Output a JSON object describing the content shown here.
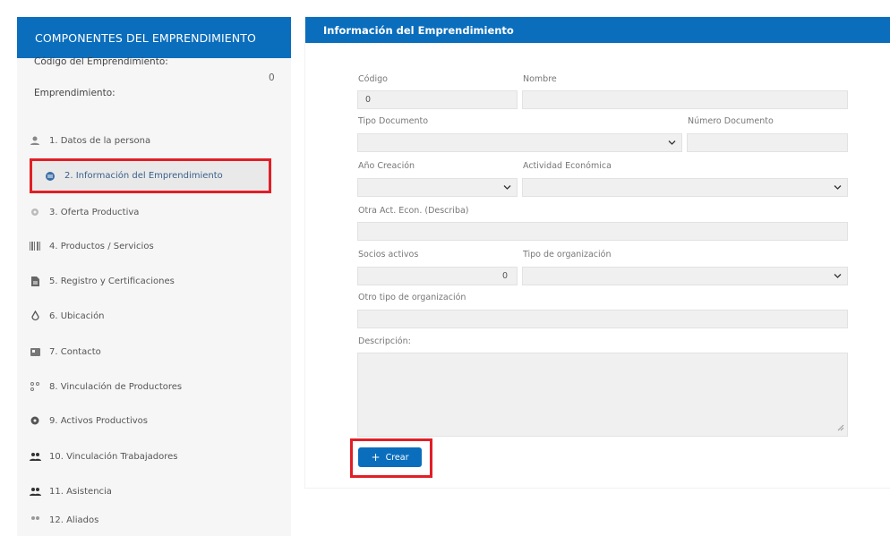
{
  "sidebar": {
    "header": "COMPONENTES DEL EMPRENDIMIENTO",
    "code_label": "Código del Emprendimiento:",
    "code_value": "0",
    "emp_label": "Emprendimiento:",
    "items": [
      {
        "label": "1. Datos de la persona",
        "icon": "person-icon"
      },
      {
        "label": "2. Información del Emprendimiento",
        "icon": "globe-icon"
      },
      {
        "label": "3. Oferta Productiva",
        "icon": "gear-icon"
      },
      {
        "label": "4. Productos / Servicios",
        "icon": "barcode-icon"
      },
      {
        "label": "5. Registro y Certificaciones",
        "icon": "document-icon"
      },
      {
        "label": "6. Ubicación",
        "icon": "map-pin-icon"
      },
      {
        "label": "7. Contacto",
        "icon": "contact-card-icon"
      },
      {
        "label": "8. Vinculación de Productores",
        "icon": "network-icon"
      },
      {
        "label": "9. Activos Productivos",
        "icon": "cog-icon"
      },
      {
        "label": "10. Vinculación Trabajadores",
        "icon": "users-icon"
      },
      {
        "label": "11. Asistencia",
        "icon": "users-icon"
      },
      {
        "label": "12. Aliados",
        "icon": "users-icon"
      }
    ]
  },
  "panel": {
    "title": "Información del Emprendimiento",
    "labels": {
      "codigo": "Código",
      "nombre": "Nombre",
      "tipo_doc": "Tipo Documento",
      "num_doc": "Número Documento",
      "anio": "Año Creación",
      "actividad": "Actividad Económica",
      "otra_act": "Otra Act. Econ. (Describa)",
      "socios": "Socios activos",
      "tipo_org": "Tipo de organización",
      "otro_tipo": "Otro tipo de organización",
      "descripcion": "Descripción:"
    },
    "values": {
      "codigo": "0",
      "socios": "0"
    },
    "create_label": "Crear"
  },
  "colors": {
    "primary": "#0a6ebd",
    "highlight": "#e11f26"
  }
}
